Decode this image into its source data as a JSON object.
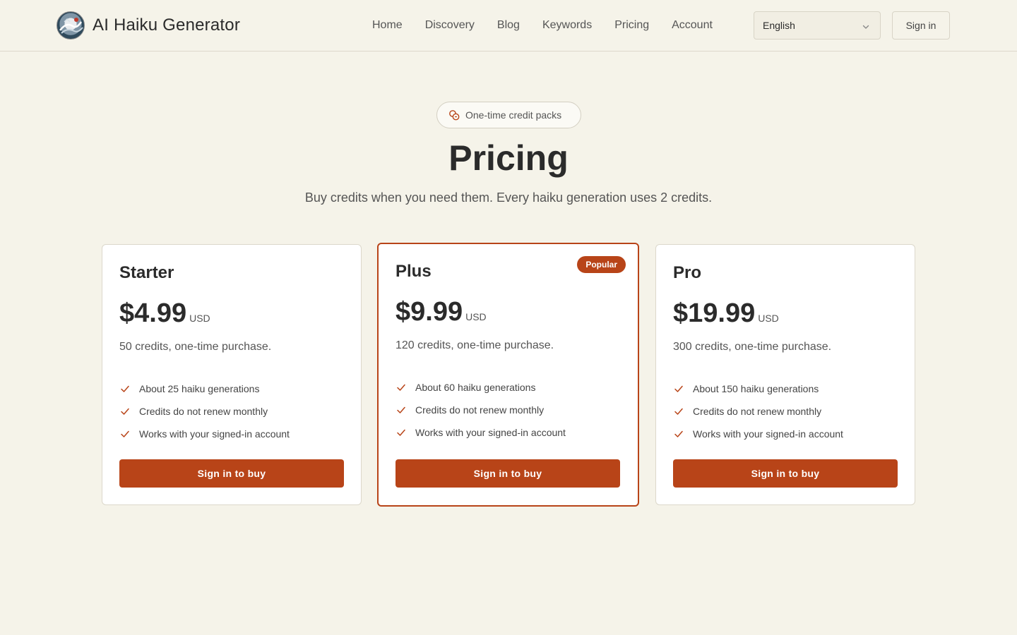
{
  "header": {
    "brand": "AI Haiku Generator",
    "nav": [
      "Home",
      "Discovery",
      "Blog",
      "Keywords",
      "Pricing",
      "Account"
    ],
    "language": "English",
    "sign_in": "Sign in"
  },
  "hero": {
    "pill": "One-time credit packs",
    "title": "Pricing",
    "subtitle": "Buy credits when you need them. Every haiku generation uses 2 credits."
  },
  "plans": [
    {
      "name": "Starter",
      "price": "$4.99",
      "currency": "USD",
      "description": "50 credits, one-time purchase.",
      "features": [
        "About 25 haiku generations",
        "Credits do not renew monthly",
        "Works with your signed-in account"
      ],
      "button": "Sign in to buy"
    },
    {
      "name": "Plus",
      "badge": "Popular",
      "price": "$9.99",
      "currency": "USD",
      "description": "120 credits, one-time purchase.",
      "features": [
        "About 60 haiku generations",
        "Credits do not renew monthly",
        "Works with your signed-in account"
      ],
      "button": "Sign in to buy"
    },
    {
      "name": "Pro",
      "price": "$19.99",
      "currency": "USD",
      "description": "300 credits, one-time purchase.",
      "features": [
        "About 150 haiku generations",
        "Credits do not renew monthly",
        "Works with your signed-in account"
      ],
      "button": "Sign in to buy"
    }
  ],
  "colors": {
    "accent": "#b84418",
    "background": "#f5f3e9",
    "card": "#ffffff"
  },
  "icons": {
    "logo": "wave-logo-icon",
    "language_chevron": "chevron-down-icon",
    "pill": "coins-icon",
    "feature": "check-icon"
  }
}
